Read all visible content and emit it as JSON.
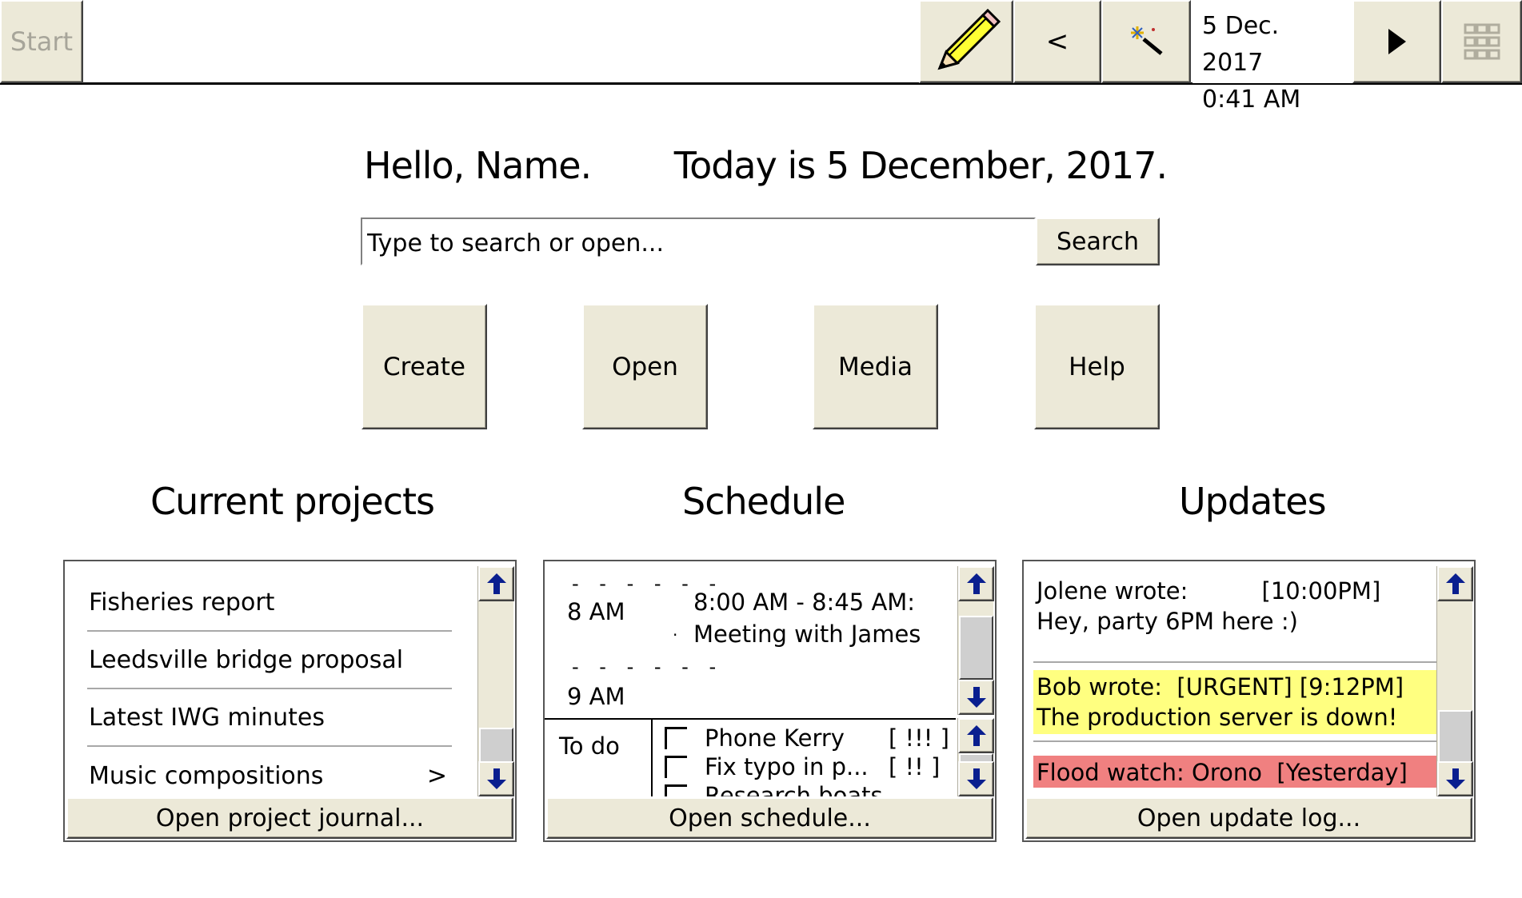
{
  "taskbar": {
    "start_label": "Start",
    "prev_label": "<",
    "date": "5 Dec. 2017",
    "time": "0:41 AM",
    "icons": [
      "pencil-icon",
      "magic-wand-icon",
      "play-right-icon",
      "grid-icon"
    ]
  },
  "greeting": {
    "hello": "Hello, Name.",
    "today": "Today is 5 December, 2017."
  },
  "search": {
    "placeholder": "Type to search or open...",
    "button_label": "Search"
  },
  "actions": {
    "create": "Create",
    "open": "Open",
    "media": "Media",
    "help": "Help"
  },
  "projects": {
    "title": "Current projects",
    "items": [
      {
        "label": "Fisheries report"
      },
      {
        "label": "Leedsville bridge proposal"
      },
      {
        "label": "Latest IWG minutes"
      },
      {
        "label": "Music compositions",
        "chevron": ">"
      }
    ],
    "footer": "Open project journal..."
  },
  "schedule": {
    "title": "Schedule",
    "slots": [
      {
        "time": "8 AM",
        "event_time": "8:00 AM - 8:45 AM:",
        "event_title": "Meeting with James"
      },
      {
        "time": "9 AM"
      }
    ],
    "dashes": "- - - - - -",
    "todo_label": "To do",
    "todos": [
      {
        "label": "Phone Kerry",
        "priority": "[ !!! ]"
      },
      {
        "label": "Fix typo in p...",
        "priority": "[  !! ]"
      },
      {
        "label": "Research boats",
        "priority": ""
      }
    ],
    "footer": "Open schedule..."
  },
  "updates": {
    "title": "Updates",
    "items": [
      {
        "line1": "Jolene wrote:          [10:00PM]",
        "line2": "Hey, party 6PM here :)",
        "color": "#ffffff"
      },
      {
        "line1": "Bob wrote:  [URGENT] [9:12PM]",
        "line2": "The production server is down!",
        "color": "#ffff80"
      },
      {
        "line1": "Flood watch: Orono  [Yesterday]",
        "line2": "",
        "color": "#f08080"
      }
    ],
    "footer": "Open update log..."
  }
}
